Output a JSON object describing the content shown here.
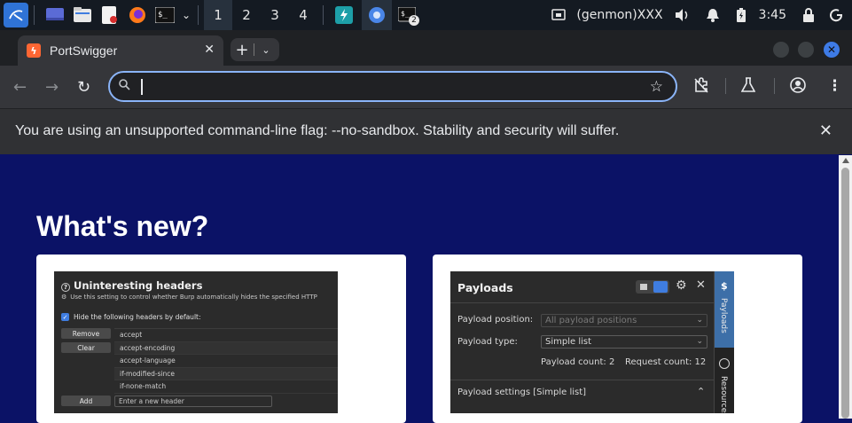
{
  "panel": {
    "workspaces": [
      "1",
      "2",
      "3",
      "4"
    ],
    "active_workspace": "1",
    "terminal_badge": "2",
    "genmon": "(genmon)XXX",
    "clock": "3:45",
    "icons": [
      "kali-menu-icon",
      "desktop-icon",
      "file-manager-icon",
      "text-editor-icon",
      "firefox-icon",
      "terminal-icon",
      "chevron-down-icon",
      "burp-icon",
      "chromium-icon",
      "terminal-window-icon",
      "network-icon",
      "volume-icon",
      "notification-icon",
      "battery-icon",
      "lock-icon",
      "power-icon"
    ]
  },
  "browser": {
    "tab_title": "PortSwigger",
    "omnibox_value": "",
    "infobar_message": "You are using an unsupported command-line flag: --no-sandbox. Stability and security will suffer."
  },
  "page": {
    "heading": "What's new?",
    "card1": {
      "title": "Uninteresting headers",
      "subtitle": "Use this setting to control whether Burp automatically hides the specified HTTP",
      "checkbox_label": "Hide the following headers by default:",
      "remove_label": "Remove",
      "clear_label": "Clear",
      "add_label": "Add",
      "add_placeholder": "Enter a new header",
      "headers": [
        "accept",
        "accept-encoding",
        "accept-language",
        "if-modified-since",
        "if-none-match",
        ""
      ]
    },
    "card2": {
      "title": "Payloads",
      "position_label": "Payload position:",
      "position_value": "All payload positions",
      "type_label": "Payload type:",
      "type_value": "Simple list",
      "payload_count": "Payload count: 2",
      "request_count": "Request count: 12",
      "settings_label": "Payload settings [Simple list]",
      "side_tab_payloads": "Payloads",
      "side_tab_resources": "Resources"
    }
  },
  "colors": {
    "page_bg": "#0b1266",
    "accent_blue": "#8ab4f8",
    "portswigger_orange": "#ff6633"
  }
}
